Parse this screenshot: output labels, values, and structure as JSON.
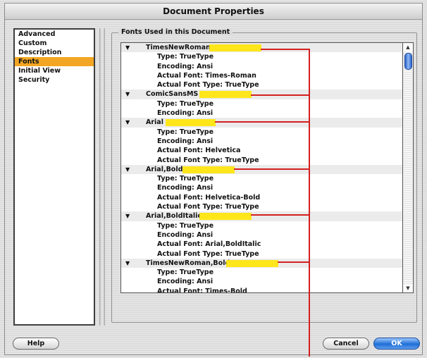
{
  "window": {
    "title": "Document Properties"
  },
  "sidebar": {
    "items": [
      {
        "label": "Advanced",
        "selected": false
      },
      {
        "label": "Custom",
        "selected": false
      },
      {
        "label": "Description",
        "selected": false
      },
      {
        "label": "Fonts",
        "selected": true
      },
      {
        "label": "Initial View",
        "selected": false
      },
      {
        "label": "Security",
        "selected": false
      }
    ]
  },
  "fonts_panel": {
    "group_title": "Fonts Used in this Document",
    "fonts": [
      {
        "name": "TimesNewRoman",
        "properties": [
          "Type: TrueType",
          "Encoding: Ansi",
          "Actual Font: Times-Roman",
          "Actual Font Type: TrueType"
        ]
      },
      {
        "name": "ComicSansMS",
        "properties": [
          "Type: TrueType",
          "Encoding: Ansi"
        ]
      },
      {
        "name": "Arial",
        "properties": [
          "Type: TrueType",
          "Encoding: Ansi",
          "Actual Font: Helvetica",
          "Actual Font Type: TrueType"
        ]
      },
      {
        "name": "Arial,Bold",
        "properties": [
          "Type: TrueType",
          "Encoding: Ansi",
          "Actual Font: Helvetica-Bold",
          "Actual Font Type: TrueType"
        ]
      },
      {
        "name": "Arial,BoldItalic",
        "properties": [
          "Type: TrueType",
          "Encoding: Ansi",
          "Actual Font: Arial,BoldItalic",
          "Actual Font Type: TrueType"
        ]
      },
      {
        "name": "TimesNewRoman,Bold",
        "properties": [
          "Type: TrueType",
          "Encoding: Ansi",
          "Actual Font: Times-Bold"
        ]
      }
    ],
    "expand_icon": "disclosure-triangle-down-icon",
    "highlight_color": "#ffe61a",
    "callout_color": "#d42020"
  },
  "scrollbar": {
    "up_icon": "scroll-up-arrow-icon",
    "down_icon": "scroll-down-arrow-icon"
  },
  "buttons": {
    "help": "Help",
    "cancel": "Cancel",
    "ok": "OK"
  },
  "colors": {
    "selection": "#f2a623",
    "primary_button": "#1f6fd6"
  }
}
